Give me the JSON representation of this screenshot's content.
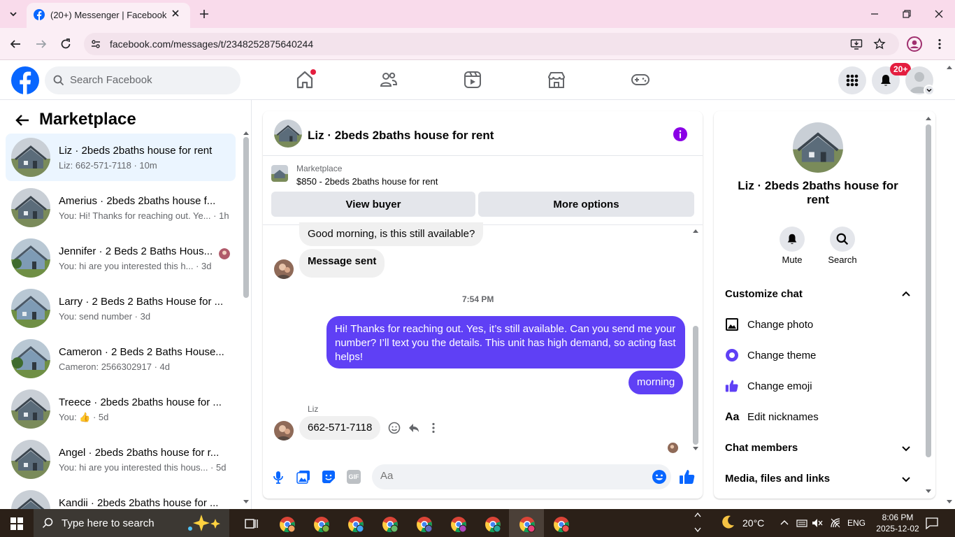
{
  "browser": {
    "tab_title": "(20+) Messenger | Facebook",
    "url": "facebook.com/messages/t/2348252875640244"
  },
  "fb_header": {
    "search_placeholder": "Search Facebook",
    "notif_badge": "20+"
  },
  "left_pane": {
    "title": "Marketplace",
    "conversations": [
      {
        "name": "Liz · 2beds 2baths house for rent",
        "preview": "Liz: 662-571-7118 · 10m",
        "selected": true
      },
      {
        "name": "Amerius · 2beds 2baths house f...",
        "preview": "You: Hi! Thanks for reaching out. Ye... · 1h"
      },
      {
        "name": "Jennifer · 2 Beds 2 Baths Hous...",
        "preview": "You: hi are you interested this h... · 3d"
      },
      {
        "name": "Larry · 2 Beds 2 Baths House for ...",
        "preview": "You: send number · 3d"
      },
      {
        "name": "Cameron · 2 Beds 2 Baths House...",
        "preview": "Cameron: 2566302917 · 4d"
      },
      {
        "name": "Treece · 2beds 2baths house for ...",
        "preview": "You: 👍 · 5d"
      },
      {
        "name": "Angel · 2beds 2baths house for r...",
        "preview": "You: hi are you interested this hous... · 5d"
      },
      {
        "name": "Kandii · 2beds 2baths house for ...",
        "preview": ""
      }
    ]
  },
  "chat": {
    "title": "Liz · 2beds 2baths house for rent",
    "marketplace_label": "Marketplace",
    "listing": "$850 - 2beds 2baths house for rent",
    "view_buyer": "View buyer",
    "more_options": "More options",
    "msg1": "Good morning, is this still available?",
    "msg2": "Message sent",
    "timestamp": "7:54 PM",
    "msg3": "Hi! Thanks for reaching out. Yes, it’s still available. Can you send me your number? I’ll text you the details. This unit has high demand, so acting fast helps!",
    "msg4": "morning",
    "sender_label": "Liz",
    "msg5": "662-571-7118",
    "composer_placeholder": "Aa",
    "gif_label": "GIF"
  },
  "right_pane": {
    "name": "Liz · 2beds 2baths house for rent",
    "mute": "Mute",
    "search": "Search",
    "customize_chat": "Customize chat",
    "change_photo": "Change photo",
    "change_theme": "Change theme",
    "change_emoji": "Change emoji",
    "edit_nicknames": "Edit nicknames",
    "nicknames_icon": "Aa",
    "chat_members": "Chat members",
    "media_files": "Media, files and links"
  },
  "taskbar": {
    "search": "Type here to search",
    "temp": "20°C",
    "lang": "ENG",
    "time": "8:06 PM",
    "date": "2025-12-02"
  },
  "colors": {
    "accent": "#5f40f5",
    "fb_blue": "#0866ff"
  }
}
